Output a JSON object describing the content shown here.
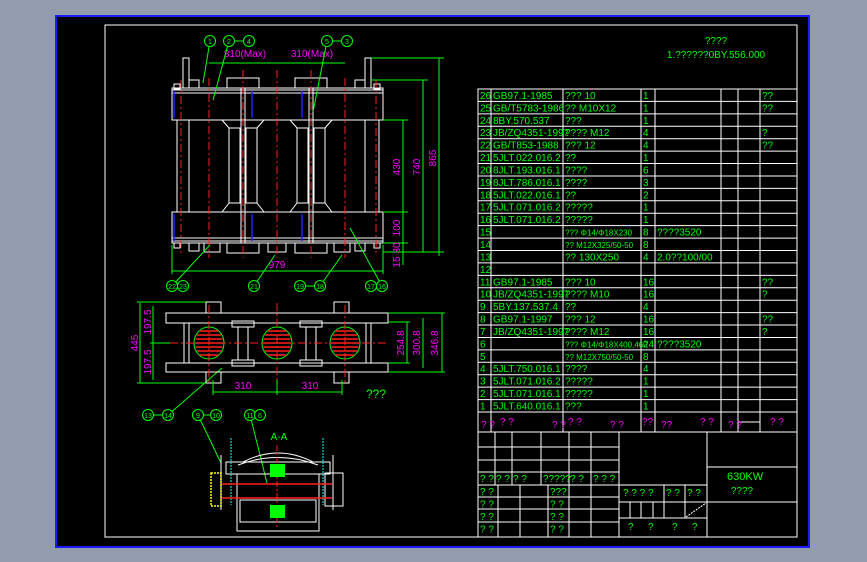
{
  "title_area": {
    "heading": "????",
    "drawing_number": "1.??????0BY.556.000"
  },
  "parts_list": [
    [
      "26",
      "GB97.1-1985",
      "??? 10",
      "1",
      "",
      "??"
    ],
    [
      "25",
      "GB/T5783-1986",
      "?? M10X12",
      "1",
      "",
      "??"
    ],
    [
      "24",
      "8BY.570.537",
      "???",
      "1",
      "",
      ""
    ],
    [
      "23",
      "JB/ZQ4351-1997",
      "???? M12",
      "4",
      "",
      "?"
    ],
    [
      "22",
      "GB/T853-1988",
      "??? 12",
      "4",
      "",
      "??"
    ],
    [
      "21",
      "5JLT.022.016.2",
      "??",
      "1",
      "",
      ""
    ],
    [
      "20",
      "8JLT.193.016.1",
      "????",
      "6",
      "",
      ""
    ],
    [
      "19",
      "8JLT.786.016.1",
      "????",
      "3",
      "",
      ""
    ],
    [
      "18",
      "5JLT.022.016.1",
      "??",
      "2",
      "",
      ""
    ],
    [
      "17",
      "5JLT.071.016.2",
      "?????",
      "1",
      "",
      ""
    ],
    [
      "16",
      "5JLT.071.016.2",
      "?????",
      "1",
      "",
      ""
    ],
    [
      "15",
      "",
      "??? Φ14/Φ18X230",
      "8",
      "????3520",
      ""
    ],
    [
      "14",
      "",
      "?? M12X325/50-50",
      "8",
      "",
      ""
    ],
    [
      "13",
      "",
      "?? 130X250",
      "4",
      "2.0??100/00",
      ""
    ],
    [
      "12",
      "",
      "",
      "",
      "",
      ""
    ],
    [
      "11",
      "GB97.1-1985",
      "??? 10",
      "16",
      "",
      "??"
    ],
    [
      "10",
      "JB/ZQ4351-1997",
      "???? M10",
      "16",
      "",
      "?"
    ],
    [
      "9",
      "5BY.137.537.4",
      "??",
      "4",
      "",
      ""
    ],
    [
      "8",
      "GB97.1-1997",
      "??? 12",
      "16",
      "",
      "??"
    ],
    [
      "7",
      "JB/ZQ4351-1997",
      "???? M12",
      "16",
      "",
      "?"
    ],
    [
      "6",
      "",
      "??? Φ14/Φ18X400,460",
      "24",
      "????3520",
      ""
    ],
    [
      "5",
      "",
      "?? M12X750/50-50",
      "8",
      "",
      ""
    ],
    [
      "4",
      "5JLT.750.016.1",
      "????",
      "4",
      "",
      ""
    ],
    [
      "3",
      "5JLT.071.016.2",
      "?????",
      "1",
      "",
      ""
    ],
    [
      "2",
      "5JLT.071.016.1",
      "?????",
      "1",
      "",
      ""
    ],
    [
      "1",
      "5JLT.640.016.1",
      "???",
      "1",
      "",
      ""
    ]
  ],
  "parts_header": [
    "? ?",
    "? ?",
    "? ?",
    "? ?",
    "? ?",
    "??",
    "??",
    "? ?",
    "? ?",
    "? ?"
  ],
  "title_block": {
    "product": "630KW",
    "product_name": "????",
    "sign_row": [
      "? ?",
      "? ?",
      "? ?",
      "?????",
      "? ?",
      "? ? ?"
    ],
    "left_labels": [
      "? ?",
      "? ?",
      "? ?",
      "? ?"
    ],
    "left_labels2": [
      "???",
      "? ?",
      "? ?",
      "? ?"
    ],
    "stage_labels": [
      "? ? ? ?",
      "? ?",
      "? ?"
    ],
    "bottom_labels": [
      "?",
      "?",
      "?",
      "?"
    ]
  },
  "drawing": {
    "dims_front": {
      "top_left": "310(Max)",
      "top_right": "310(Max)",
      "width": "979",
      "h430": "430",
      "h740": "740",
      "h865": "865",
      "h100": "100",
      "h30": "30",
      "h15": "15"
    },
    "dims_plan": {
      "total": "445",
      "half_top": "197.5",
      "half_bottom": "197.5",
      "d1": "254.8",
      "d2": "300.8",
      "d3": "346.8",
      "pitch_left": "310",
      "pitch_right": "310",
      "caption": "???"
    },
    "section_label": "A-A",
    "balloons_front_top": [
      "1",
      "2",
      "4",
      "5",
      "3"
    ],
    "balloons_front_bottom": [
      "22",
      "23",
      "21",
      "19",
      "18",
      "17",
      "16"
    ],
    "balloons_plan": [
      "13",
      "14",
      "9",
      "10",
      "11",
      "6"
    ]
  }
}
